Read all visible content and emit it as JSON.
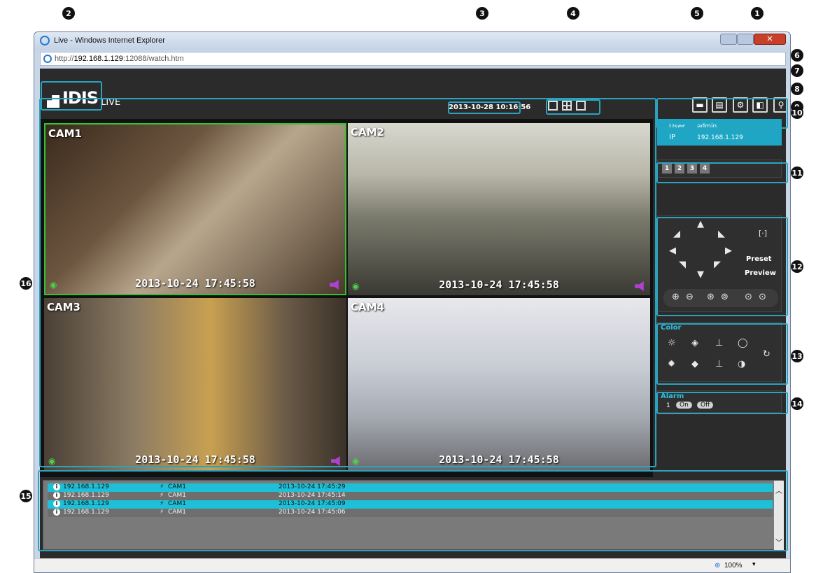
{
  "window": {
    "title": "Live - Windows Internet Explorer",
    "url_prefix": "http://",
    "url_host": "192.168.1.129",
    "url_rest": ":12088/watch.htm",
    "zoom": "100%"
  },
  "header": {
    "logo": "IDIS",
    "logo_suffix": "LIVE",
    "datetime": "2013-10-28 10:16:56"
  },
  "cameras": [
    {
      "label": "CAM1",
      "timestamp": "2013-10-24 17:45:58"
    },
    {
      "label": "CAM2",
      "timestamp": "2013-10-24 17:45:58"
    },
    {
      "label": "CAM3",
      "timestamp": "2013-10-24 17:45:58"
    },
    {
      "label": "CAM4",
      "timestamp": "2013-10-24 17:45:58"
    }
  ],
  "user_panel": {
    "user_label": "User",
    "user_value": "admin",
    "ip_label": "IP",
    "ip_value": "192.168.1.129"
  },
  "pages": [
    "1",
    "2",
    "3",
    "4"
  ],
  "ptz": {
    "preset": "Preset",
    "preview": "Preview"
  },
  "color_panel": {
    "title": "Color"
  },
  "alarm_panel": {
    "title": "Alarm",
    "index": "1",
    "on": "On",
    "off": "Off"
  },
  "events": [
    {
      "ip": "192.168.1.129",
      "cam": "CAM1",
      "time": "2013-10-24 17:45:29",
      "highlight": true
    },
    {
      "ip": "192.168.1.129",
      "cam": "CAM1",
      "time": "2013-10-24 17:45:14",
      "highlight": false
    },
    {
      "ip": "192.168.1.129",
      "cam": "CAM1",
      "time": "2013-10-24 17:45:09",
      "highlight": true
    },
    {
      "ip": "192.168.1.129",
      "cam": "CAM1",
      "time": "2013-10-24 17:45:06",
      "highlight": false
    }
  ],
  "callouts": [
    "1",
    "2",
    "3",
    "4",
    "5",
    "6",
    "7",
    "8",
    "9",
    "10",
    "11",
    "12",
    "13",
    "14",
    "15",
    "16"
  ]
}
